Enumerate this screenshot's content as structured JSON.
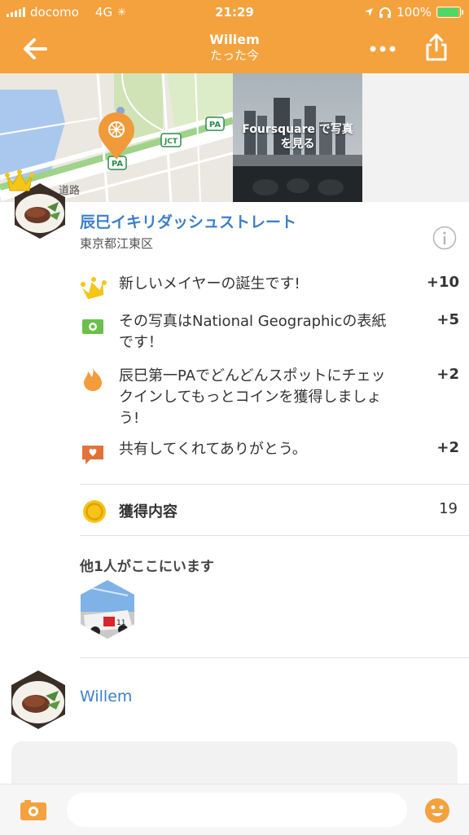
{
  "status_bar": {
    "carrier": "docomo",
    "network": "4G",
    "time": "21:29",
    "battery": "100%",
    "battery_level": 1.0
  },
  "nav": {
    "title": "Willem",
    "subtitle": "たった今"
  },
  "banner": {
    "map_labels": [
      "PA",
      "JCT",
      "PA",
      "道路"
    ],
    "photo_caption_line1": "Foursquare で写真",
    "photo_caption_line2": "を見る"
  },
  "venue": {
    "name": "辰巳イキリダッシュストレート",
    "location": "東京都江東区"
  },
  "rewards": [
    {
      "icon": "crown-icon",
      "text": "新しいメイヤーの誕生です!",
      "points": "+10"
    },
    {
      "icon": "camera-icon",
      "text": "その写真はNational Geographicの表紙です！",
      "points": "+5"
    },
    {
      "icon": "flame-icon",
      "text": "辰巳第一PAでどんどんスポットにチェックインしてもっとコインを獲得しましょう!",
      "points": "+2"
    },
    {
      "icon": "heart-bubble-icon",
      "text": "共有してくれてありがとう。",
      "points": "+2"
    }
  ],
  "total": {
    "label": "獲得内容",
    "value": "19"
  },
  "others": {
    "title": "他1人がここにいます"
  },
  "user": {
    "name": "Willem"
  },
  "comment": {
    "placeholder": ""
  },
  "colors": {
    "brand_orange": "#f4a23e",
    "link_blue": "#3d7fc9",
    "coin_yellow": "#f5c518",
    "flame_orange": "#f39c3b"
  }
}
